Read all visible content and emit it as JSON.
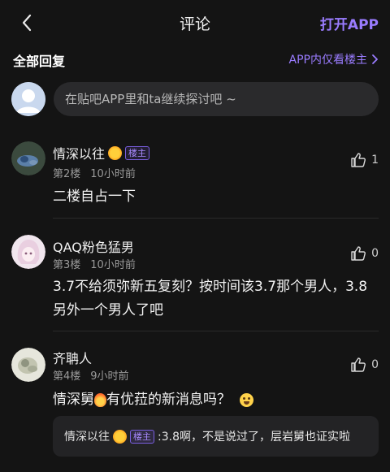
{
  "header": {
    "title": "评论",
    "open_app": "打开APP",
    "back_icon": "chevron-left-icon"
  },
  "section": {
    "title": "全部回复",
    "only_lz": "APP内仅看楼主"
  },
  "reply_box": {
    "placeholder": "在贴吧APP里和ta继续探讨吧 ~"
  },
  "colors": {
    "background": "#141414",
    "accent": "#9a7cff"
  },
  "comments": [
    {
      "username": "情深以往",
      "has_sun": true,
      "is_lz": true,
      "badge": "楼主",
      "floor": "第2楼",
      "time": "10小时前",
      "likes": "1",
      "text": "二楼自占一下"
    },
    {
      "username": "QAQ粉色猛男",
      "floor": "第3楼",
      "time": "10小时前",
      "likes": "0",
      "text": "3.7不给须弥新五复刻？按时间该3.7那个男人，3.8另外一个男人了吧"
    },
    {
      "username": "齐聃人",
      "floor": "第4楼",
      "time": "9小时前",
      "likes": "0",
      "text_before": "情深舅",
      "text_after": "有优菈的新消息吗？",
      "sub_reply": {
        "author": "情深以往",
        "badge": "楼主",
        "text": ":3.8啊，不是说过了，层岩舅也证实啦"
      }
    }
  ]
}
